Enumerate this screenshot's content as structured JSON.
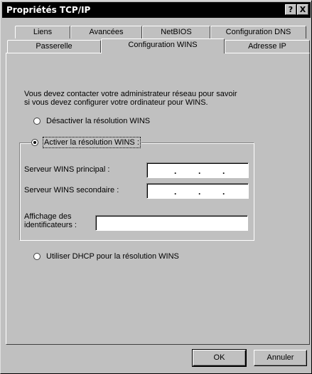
{
  "window": {
    "title": "Propriétés TCP/IP",
    "help_label": "?",
    "close_label": "X"
  },
  "tabs_back": [
    {
      "label": "Liens"
    },
    {
      "label": "Avancées"
    },
    {
      "label": "NetBIOS"
    },
    {
      "label": "Configuration DNS"
    }
  ],
  "tabs_front": [
    {
      "label": "Passerelle"
    },
    {
      "label": "Configuration WINS",
      "active": true
    },
    {
      "label": "Adresse IP"
    }
  ],
  "content": {
    "intro_text": "Vous devez contacter votre administrateur réseau pour savoir si vous devez configurer votre ordinateur pour WINS.",
    "radio_disable": "Désactiver la résolution WINS",
    "radio_enable": "Activer la résolution WINS :",
    "primary_label": "Serveur WINS principal :",
    "secondary_label": "Serveur WINS secondaire :",
    "primary_value": ".      .      .",
    "secondary_value": ".      .      .",
    "display_label": "Affichage des identificateurs :",
    "display_value": "",
    "radio_dhcp": "Utiliser DHCP pour la résolution WINS",
    "selected_option": "enable"
  },
  "buttons": {
    "ok": "OK",
    "cancel": "Annuler"
  }
}
